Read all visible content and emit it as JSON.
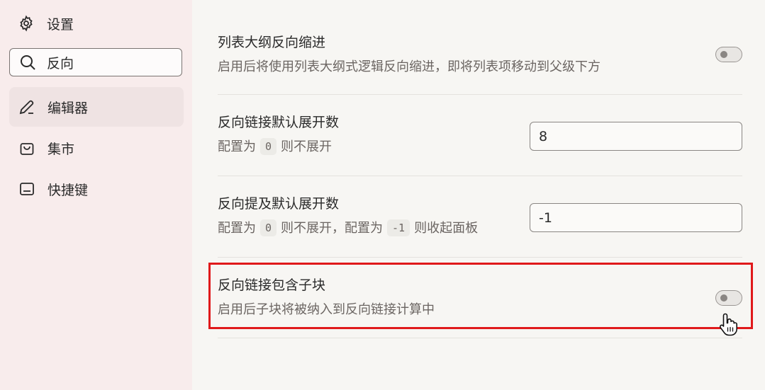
{
  "sidebar": {
    "title": "设置",
    "search": {
      "value": "反向",
      "placeholder": ""
    },
    "items": [
      {
        "label": "编辑器",
        "icon": "pen-icon",
        "active": true
      },
      {
        "label": "集市",
        "icon": "bag-icon",
        "active": false
      },
      {
        "label": "快捷键",
        "icon": "keyboard-icon",
        "active": false
      }
    ]
  },
  "settings": [
    {
      "title": "列表大纲反向缩进",
      "desc": "启用后将使用列表大纲式逻辑反向缩进，即将列表项移动到父级下方",
      "control": "toggle",
      "enabled": false
    },
    {
      "title": "反向链接默认展开数",
      "desc_pre": "配置为",
      "desc_code": "0",
      "desc_post": "则不展开",
      "control": "input",
      "value": "8"
    },
    {
      "title": "反向提及默认展开数",
      "desc_pre": "配置为",
      "desc_code": "0",
      "desc_mid": "则不展开，配置为",
      "desc_code2": "-1",
      "desc_post": "则收起面板",
      "control": "input",
      "value": "-1"
    },
    {
      "title": "反向链接包含子块",
      "desc": "启用后子块将被纳入到反向链接计算中",
      "control": "toggle",
      "enabled": false
    }
  ],
  "colors": {
    "sidebar_bg": "#f8ecec",
    "main_bg": "#f7f6f3",
    "highlight": "#e0191b"
  }
}
